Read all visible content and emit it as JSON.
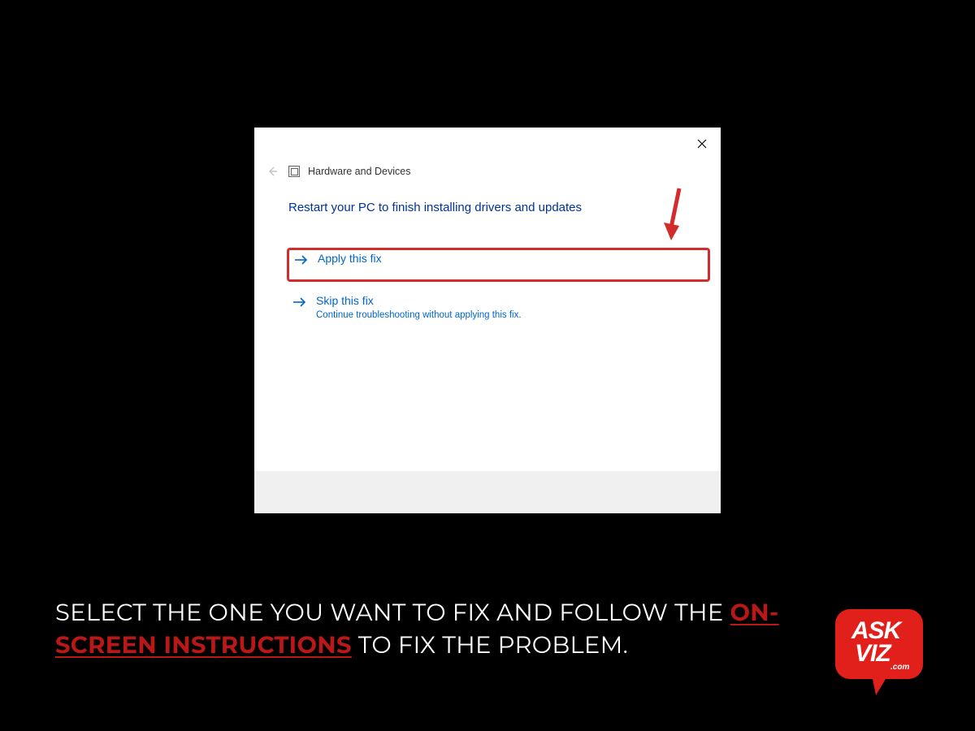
{
  "dialog": {
    "title": "Hardware and Devices",
    "instruction": "Restart your PC to finish installing drivers and updates",
    "options": [
      {
        "label": "Apply this fix",
        "sub": ""
      },
      {
        "label": "Skip this fix",
        "sub": "Continue troubleshooting without applying this fix."
      }
    ]
  },
  "caption": {
    "part1": "SELECT THE ONE YOU WANT TO FIX AND FOLLOW THE ",
    "highlight": "ON-SCREEN INSTRUCTIONS",
    "part2": " TO FIX THE PROBLEM."
  },
  "badge": {
    "line1": "ASK",
    "line2": "VIZ",
    "dotcom": ".com"
  },
  "colors": {
    "highlight_red": "#d22c2c",
    "caption_red": "#b81818",
    "link_blue": "#0066cc",
    "instruction_blue": "#003399"
  }
}
